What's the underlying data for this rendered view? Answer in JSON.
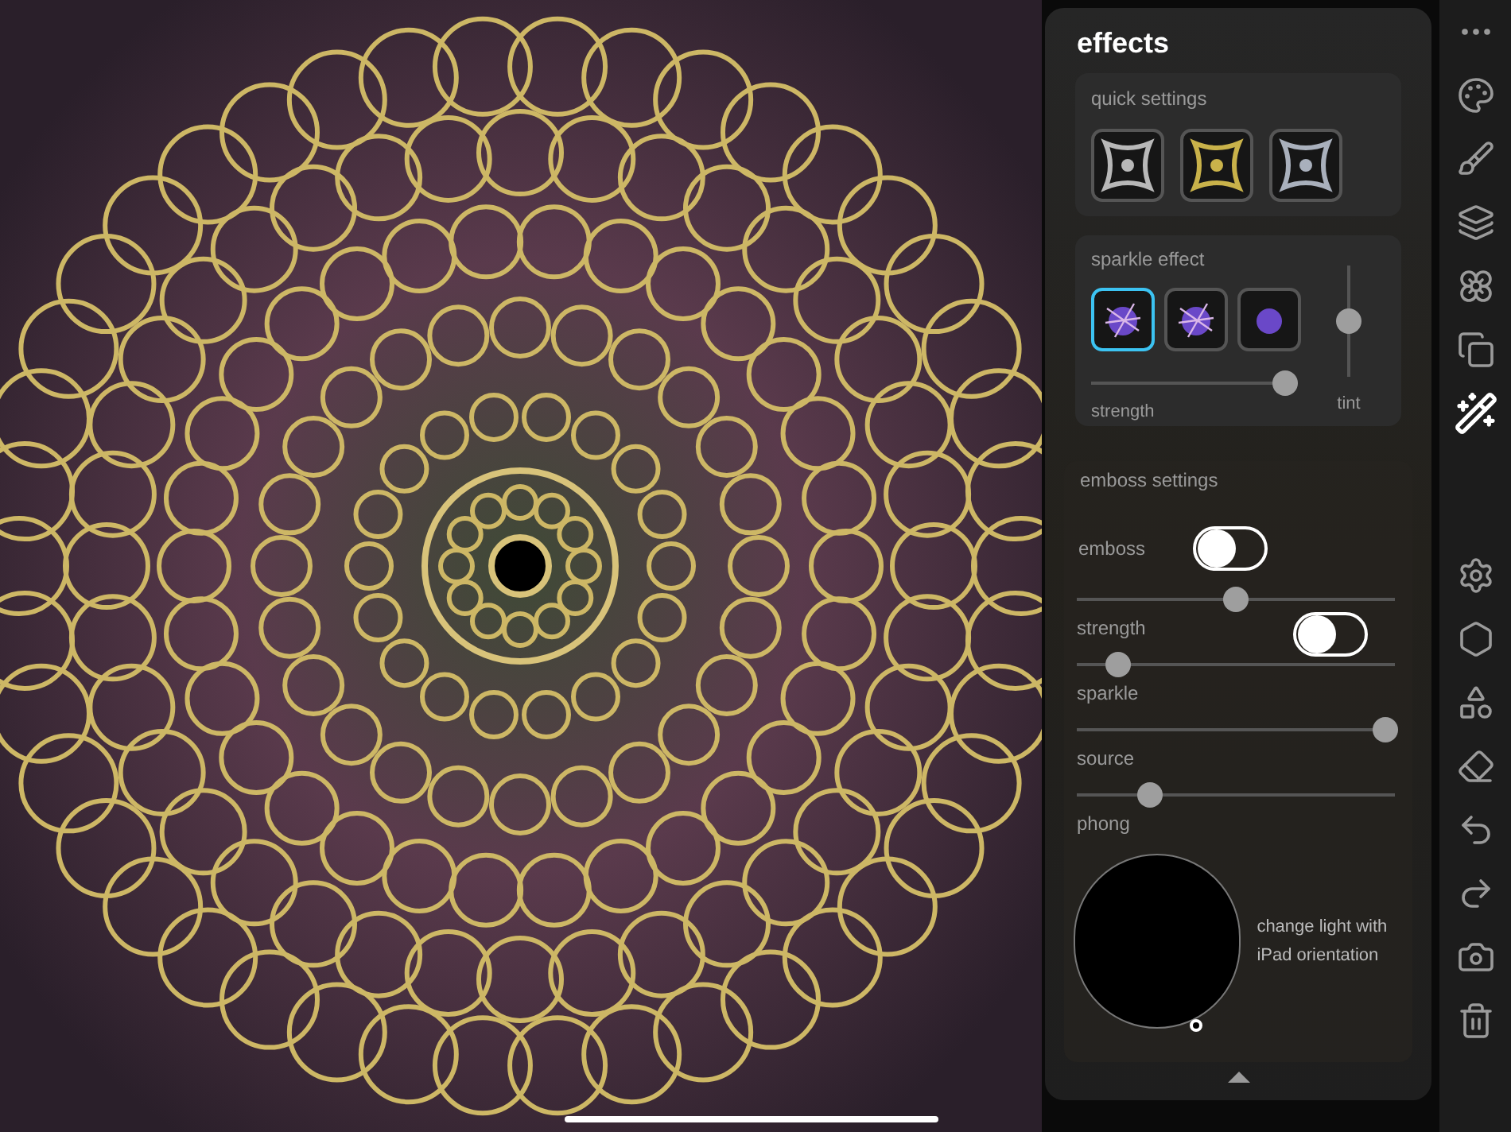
{
  "panel": {
    "title": "effects",
    "quick_settings": {
      "title": "quick settings",
      "presets": [
        {
          "color": "#b8b8b8"
        },
        {
          "color": "#c9b24a"
        },
        {
          "color": "#a9b0bc"
        }
      ]
    },
    "sparkle_effect": {
      "title": "sparkle effect",
      "options": [
        {
          "selected": true
        },
        {
          "selected": false
        },
        {
          "selected": false
        }
      ],
      "strength": {
        "label": "strength",
        "level": 0.95
      },
      "tint": {
        "label": "tint",
        "level": 0.5
      }
    },
    "emboss_settings": {
      "title": "emboss settings",
      "emboss": {
        "label": "emboss",
        "on": false
      },
      "sliders": [
        {
          "label": "strength",
          "level": 0.5,
          "toggle": {
            "on": false
          }
        },
        {
          "label": "sparkle",
          "level": 0.13
        },
        {
          "label": "source",
          "level": 0.97
        },
        {
          "label": "phong",
          "level": 0.23
        }
      ],
      "light": {
        "caption": "change light with iPad orientation"
      }
    }
  },
  "tools_top": [
    {
      "kind": "more",
      "selected": false
    },
    {
      "kind": "palette",
      "selected": false
    },
    {
      "kind": "brush",
      "selected": false
    },
    {
      "kind": "layers",
      "selected": false
    },
    {
      "kind": "mandala",
      "selected": false
    },
    {
      "kind": "paper",
      "selected": false
    },
    {
      "kind": "wand",
      "selected": true
    }
  ],
  "tools_bottom": [
    {
      "kind": "settings",
      "selected": false
    },
    {
      "kind": "grid",
      "selected": false
    },
    {
      "kind": "shapes",
      "selected": false
    },
    {
      "kind": "eraser",
      "selected": false
    },
    {
      "kind": "undo",
      "selected": false
    },
    {
      "kind": "redo",
      "selected": false
    },
    {
      "kind": "export",
      "selected": false
    },
    {
      "kind": "trash",
      "selected": false
    }
  ]
}
